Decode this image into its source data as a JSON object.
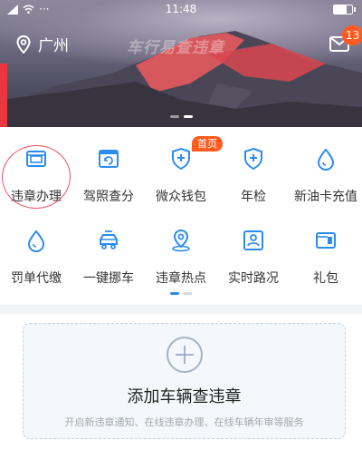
{
  "status_bar": {
    "time": "11:48",
    "dots": "···"
  },
  "header": {
    "city": "广州",
    "watermark": "车行易查违章",
    "mail_badge": "13"
  },
  "grid": {
    "row1": [
      {
        "label": "违章办理",
        "icon": "violation-card-icon"
      },
      {
        "label": "驾照查分",
        "icon": "license-score-icon"
      },
      {
        "label": "微众钱包",
        "icon": "wallet-shield-icon",
        "tag": "首页"
      },
      {
        "label": "年检",
        "icon": "inspection-shield-icon"
      },
      {
        "label": "新油卡充值",
        "icon": "fuel-drop-icon"
      }
    ],
    "row2": [
      {
        "label": "罚单代缴",
        "icon": "fine-drop-icon"
      },
      {
        "label": "一键挪车",
        "icon": "move-car-icon"
      },
      {
        "label": "违章热点",
        "icon": "location-pin-icon"
      },
      {
        "label": "实时路况",
        "icon": "traffic-map-icon"
      },
      {
        "label": "礼包",
        "icon": "gift-card-icon"
      }
    ]
  },
  "add_vehicle": {
    "title": "添加车辆查违章",
    "subtitle": "开启新违章通知、在线违章办理、在线车辆年审等服务"
  },
  "colors": {
    "primary": "#2b8cf0",
    "badge": "#ff5b21",
    "annotation": "#e85064"
  }
}
